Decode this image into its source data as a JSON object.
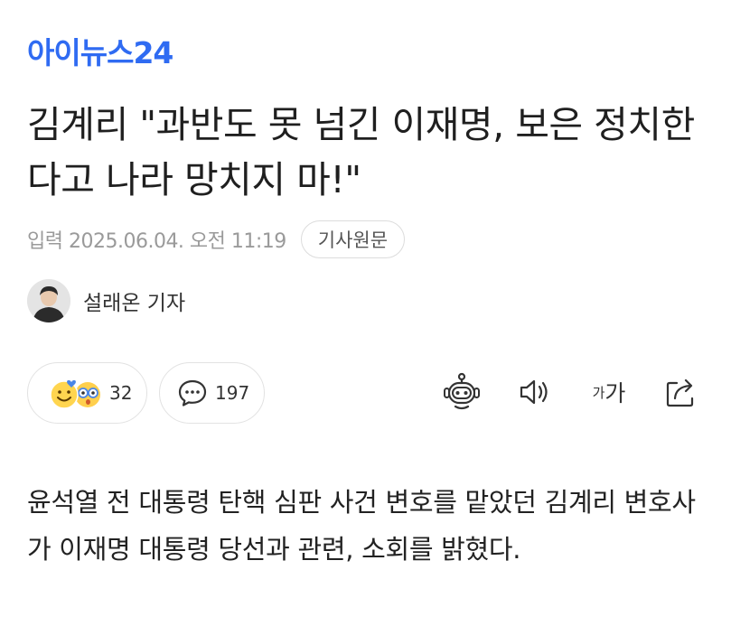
{
  "brand": {
    "logo_text": "아이뉴스24",
    "accent": "#2f6bf2"
  },
  "article": {
    "headline": "김계리 \"과반도 못 넘긴 이재명, 보은 정치한다고 나라 망치지 마!\"",
    "date_text": "입력 2025.06.04. 오전 11:19",
    "source_button": "기사원문",
    "author": "설래온 기자",
    "body": "윤석열 전 대통령 탄핵 심판 사건 변호를 맡았던 김계리 변호사가 이재명 대통령 당선과 관련, 소회를 밝혔다."
  },
  "reactions": {
    "like_count": "32",
    "comment_count": "197"
  },
  "toolbar": {
    "font_small": "가",
    "font_big": "가",
    "icons": [
      "ai-summary-bot-icon",
      "speaker-icon",
      "font-size-icon",
      "share-icon"
    ]
  }
}
